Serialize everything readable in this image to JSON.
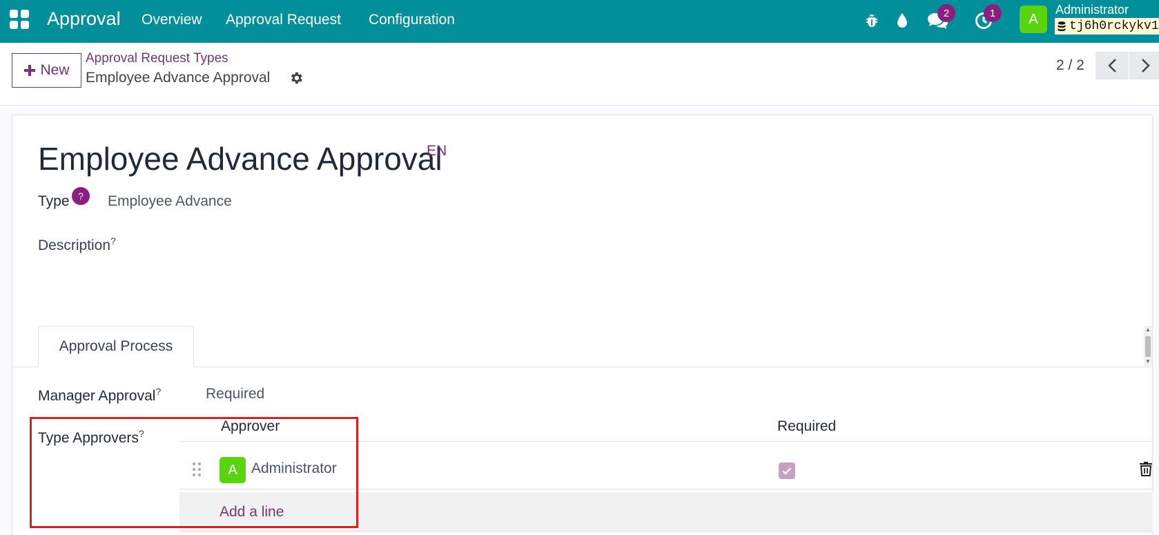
{
  "navbar": {
    "brand": "Approval",
    "menu": [
      "Overview",
      "Approval Request",
      "Configuration"
    ],
    "messages_count": "2",
    "activities_count": "1",
    "user_initial": "A",
    "user_name": "Administrator",
    "db_name": "tj6h0rckykv1"
  },
  "control": {
    "new_label": "New",
    "breadcrumb_parent": "Approval Request Types",
    "breadcrumb_current": "Employee Advance Approval",
    "pager": "2 / 2"
  },
  "form": {
    "title": "Employee Advance Approval",
    "lang": "EN",
    "type_label": "Type",
    "type_help": "?",
    "type_value": "Employee Advance",
    "description_label": "Description",
    "help_mark": "?",
    "tab_label": "Approval Process",
    "manager_approval_label": "Manager Approval",
    "manager_approval_value": "Required",
    "type_approvers_label": "Type Approvers",
    "columns": {
      "approver": "Approver",
      "required": "Required"
    },
    "approvers": [
      {
        "initial": "A",
        "name": "Administrator",
        "required": true
      }
    ],
    "add_line": "Add a line"
  },
  "colors": {
    "navbar": "#018f9c",
    "accent": "#71396c",
    "badge": "#8a1f82",
    "avatar": "#5bd410",
    "highlight": "#e11d1d"
  }
}
